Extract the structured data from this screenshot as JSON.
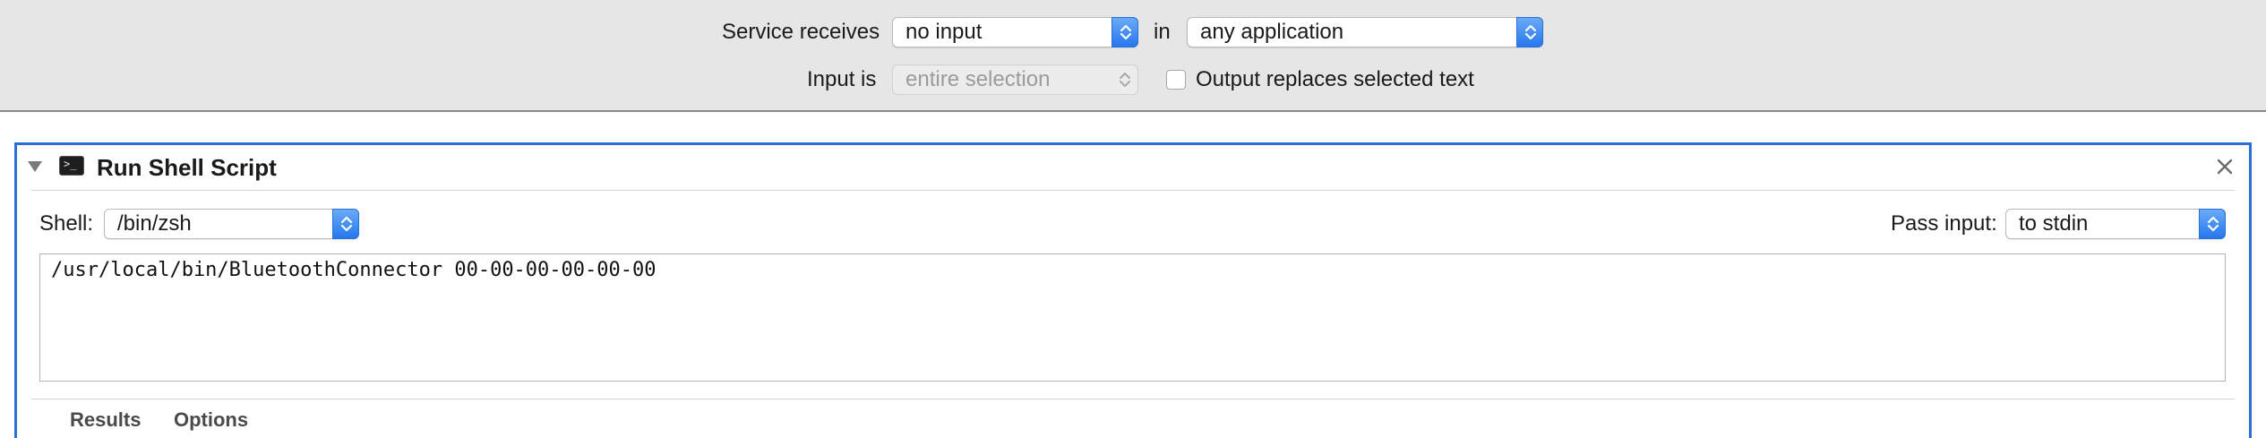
{
  "service_bar": {
    "receives_label": "Service receives",
    "receives_value": "no input",
    "in_label": "in",
    "app_value": "any application",
    "input_is_label": "Input is",
    "input_is_value": "entire selection",
    "output_replaces_label": "Output replaces selected text",
    "output_replaces_checked": false
  },
  "action": {
    "title": "Run Shell Script",
    "icon": "terminal-icon",
    "shell_label": "Shell:",
    "shell_value": "/bin/zsh",
    "pass_input_label": "Pass input:",
    "pass_input_value": "to stdin",
    "script": "/usr/local/bin/BluetoothConnector 00-00-00-00-00-00",
    "tabs": [
      {
        "label": "Results"
      },
      {
        "label": "Options"
      }
    ]
  },
  "colors": {
    "accent": "#2a6fd8",
    "toolbar_bg": "#e6e6e6",
    "stepper_blue": "#2677ee"
  }
}
